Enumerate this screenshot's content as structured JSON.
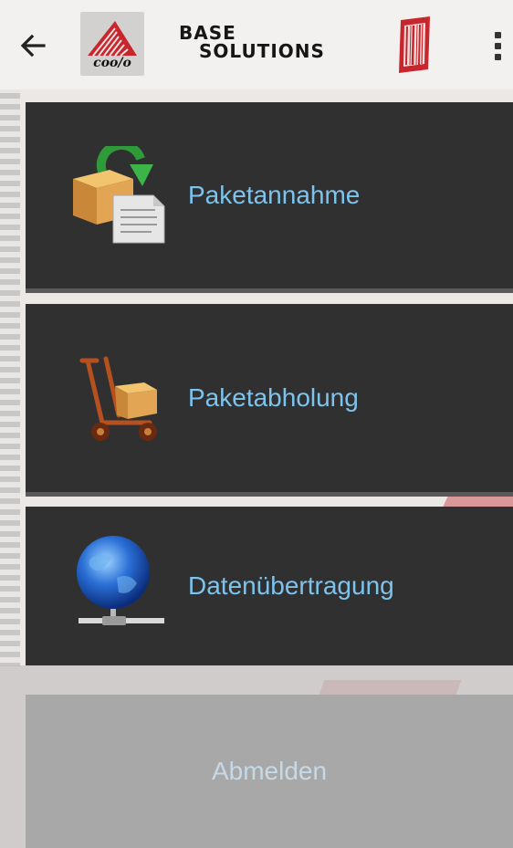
{
  "header": {
    "back_icon": "arrow-left-icon",
    "logo_left_text": "coo/o",
    "brand_line1": "BASE",
    "brand_line2": "SOLUTIONS",
    "barcode_icon": "barcode-icon",
    "more_icon": "more-vert-icon"
  },
  "menu": {
    "items": [
      {
        "label": "Paketannahme",
        "icon": "package-receive-icon"
      },
      {
        "label": "Paketabholung",
        "icon": "hand-truck-icon"
      },
      {
        "label": "Datenübertragung",
        "icon": "globe-network-icon"
      }
    ],
    "logout_label": "Abmelden"
  },
  "colors": {
    "card_bg": "#313030",
    "label_blue": "#7cc3ee",
    "accent_red": "#c8262d"
  }
}
